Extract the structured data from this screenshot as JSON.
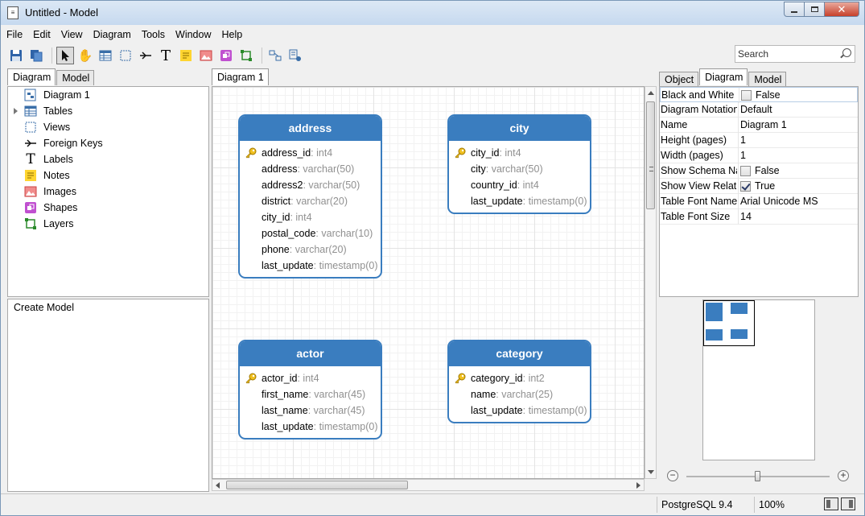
{
  "window": {
    "title": "Untitled - Model",
    "icon": "document-icon"
  },
  "menu": [
    "File",
    "Edit",
    "View",
    "Diagram",
    "Tools",
    "Window",
    "Help"
  ],
  "search": {
    "placeholder": "Search"
  },
  "left_tabs": [
    "Diagram",
    "Model"
  ],
  "tree": {
    "items": [
      {
        "label": "Diagram 1",
        "icon": "diagram-icon"
      },
      {
        "label": "Tables",
        "icon": "table-icon"
      },
      {
        "label": "Views",
        "icon": "view-icon"
      },
      {
        "label": "Foreign Keys",
        "icon": "foreign-key-icon"
      },
      {
        "label": "Labels",
        "icon": "label-icon"
      },
      {
        "label": "Notes",
        "icon": "note-icon"
      },
      {
        "label": "Images",
        "icon": "image-icon"
      },
      {
        "label": "Shapes",
        "icon": "shape-icon"
      },
      {
        "label": "Layers",
        "icon": "layer-icon"
      }
    ]
  },
  "left_bottom": {
    "label": "Create Model"
  },
  "canvas_tab": "Diagram 1",
  "entities": {
    "address": {
      "name": "address",
      "fields": [
        {
          "name": "address_id",
          "type": ": int4",
          "pk": true
        },
        {
          "name": "address",
          "type": ": varchar(50)"
        },
        {
          "name": "address2",
          "type": ": varchar(50)"
        },
        {
          "name": "district",
          "type": ": varchar(20)"
        },
        {
          "name": "city_id",
          "type": ": int4"
        },
        {
          "name": "postal_code",
          "type": ": varchar(10)"
        },
        {
          "name": "phone",
          "type": ": varchar(20)"
        },
        {
          "name": "last_update",
          "type": ": timestamp(0)"
        }
      ]
    },
    "city": {
      "name": "city",
      "fields": [
        {
          "name": "city_id",
          "type": ": int4",
          "pk": true
        },
        {
          "name": "city",
          "type": ": varchar(50)"
        },
        {
          "name": "country_id",
          "type": ": int4"
        },
        {
          "name": "last_update",
          "type": ": timestamp(0)"
        }
      ]
    },
    "actor": {
      "name": "actor",
      "fields": [
        {
          "name": "actor_id",
          "type": ": int4",
          "pk": true
        },
        {
          "name": "first_name",
          "type": ": varchar(45)"
        },
        {
          "name": "last_name",
          "type": ": varchar(45)"
        },
        {
          "name": "last_update",
          "type": ": timestamp(0)"
        }
      ]
    },
    "category": {
      "name": "category",
      "fields": [
        {
          "name": "category_id",
          "type": ": int2",
          "pk": true
        },
        {
          "name": "name",
          "type": ": varchar(25)"
        },
        {
          "name": "last_update",
          "type": ": timestamp(0)"
        }
      ]
    }
  },
  "right_tabs": [
    "Object",
    "Diagram",
    "Model"
  ],
  "properties": [
    {
      "key": "Black and White",
      "value": "False",
      "checkbox": "unchecked"
    },
    {
      "key": "Diagram Notation",
      "value": "Default"
    },
    {
      "key": "Name",
      "value": "Diagram 1"
    },
    {
      "key": "Height (pages)",
      "value": "1"
    },
    {
      "key": "Width (pages)",
      "value": "1"
    },
    {
      "key": "Show Schema Nar",
      "value": "False",
      "checkbox": "unchecked"
    },
    {
      "key": "Show View Relatio",
      "value": "True",
      "checkbox": "checked"
    },
    {
      "key": "Table Font Name",
      "value": "Arial Unicode MS"
    },
    {
      "key": "Table Font Size",
      "value": "14"
    }
  ],
  "zoom": {
    "minus": "−",
    "plus": "+",
    "level": 0.5
  },
  "status": {
    "db": "PostgreSQL 9.4",
    "zoom": "100%"
  },
  "colors": {
    "entity_header": "#3a7dbf",
    "type_text": "#909090"
  }
}
